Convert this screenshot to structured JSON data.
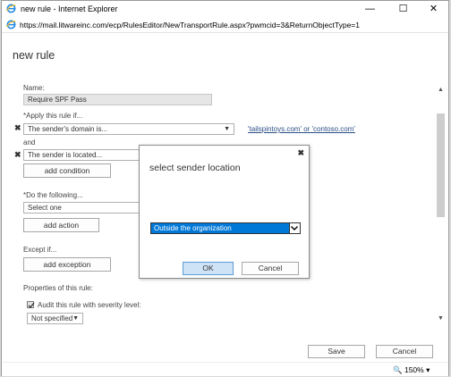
{
  "window": {
    "title": "new rule - Internet Explorer"
  },
  "address_bar": {
    "url": "https://mail.litwareinc.com/ecp/RulesEditor/NewTransportRule.aspx?pwmcid=3&ReturnObjectType=1"
  },
  "page": {
    "title": "new rule",
    "name_label": "Name:",
    "name_value": "Require SPF Pass",
    "apply_label": "*Apply this rule if...",
    "condition1": "The sender's domain is...",
    "condition1_link": "'tailspintoys.com' or 'contoso.com'",
    "and_label": "and",
    "condition2": "The sender is located...",
    "add_condition": "add condition",
    "do_label": "*Do the following...",
    "action_select": "Select one",
    "add_action": "add action",
    "except_label": "Except if...",
    "add_exception": "add exception",
    "properties_label": "Properties of this rule:",
    "audit_label": "Audit this rule with severity level:",
    "audit_checked": true,
    "severity_value": "Not specified",
    "save": "Save",
    "cancel": "Cancel"
  },
  "dialog": {
    "title": "select sender location",
    "selected": "Outside the organization",
    "ok": "OK",
    "cancel": "Cancel"
  },
  "status": {
    "zoom": "150%"
  },
  "colors": {
    "accent": "#0078d7",
    "link": "#2b4f85"
  },
  "icons": [
    "ie-icon",
    "minimize-icon",
    "maximize-icon",
    "close-icon",
    "x-icon",
    "chevron-down-icon",
    "checkmark-icon",
    "zoom-icon"
  ]
}
